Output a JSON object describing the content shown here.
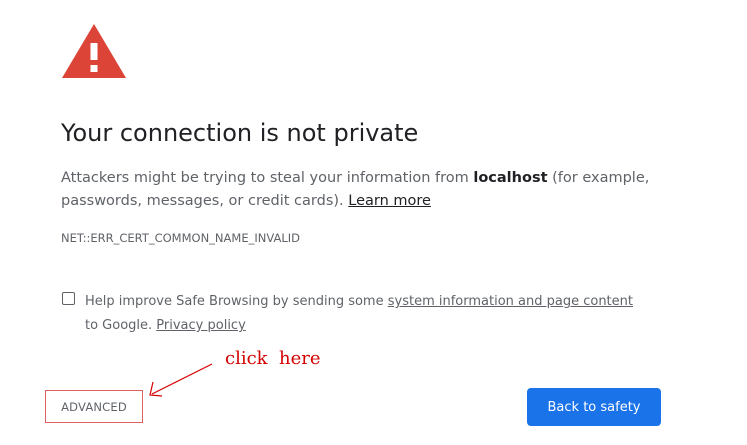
{
  "interstitial": {
    "icon": "warning-triangle-icon",
    "icon_color": "#db4437",
    "title": "Your connection is not private",
    "description_pre": "Attackers might be trying to steal your information from ",
    "host": "localhost",
    "description_post": " (for example, passwords, messages, or credit cards). ",
    "learn_more": "Learn more",
    "error_code": "NET::ERR_CERT_COMMON_NAME_INVALID"
  },
  "safe_browsing": {
    "checked": false,
    "text_pre": "Help improve Safe Browsing by sending some ",
    "system_info_link": "system information and page content",
    "text_mid": " to Google. ",
    "privacy_link": "Privacy policy"
  },
  "buttons": {
    "advanced": "ADVANCED",
    "back_to_safety": "Back to safety",
    "primary_color": "#1a73e8"
  },
  "annotation": {
    "text": "click  here",
    "color": "#d40000"
  }
}
